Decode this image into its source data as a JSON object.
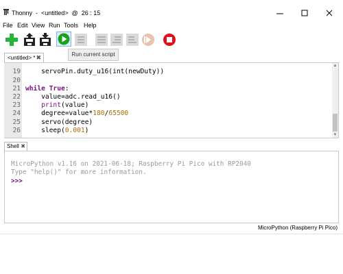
{
  "window": {
    "title": "Thonny  -  <untitled>  @  26 : 15",
    "app_icon": "thonny-logo-icon",
    "controls": [
      "minimize-icon",
      "maximize-icon",
      "close-icon"
    ]
  },
  "menu": [
    "File",
    "Edit",
    "View",
    "Run",
    "Tools",
    "Help"
  ],
  "toolbar": {
    "buttons": [
      {
        "name": "new-file-button",
        "icon": "plus-icon",
        "color": "#27b43a"
      },
      {
        "name": "open-file-button",
        "icon": "open-icon"
      },
      {
        "name": "save-file-button",
        "icon": "save-icon"
      },
      {
        "name": "run-button",
        "icon": "play-icon",
        "color": "#1ba11b"
      },
      {
        "name": "debug-button",
        "icon": "debug-icon",
        "enabled": false
      },
      {
        "name": "step-over-button",
        "icon": "step-over-icon",
        "enabled": false
      },
      {
        "name": "step-into-button",
        "icon": "step-into-icon",
        "enabled": false
      },
      {
        "name": "step-out-button",
        "icon": "step-out-icon",
        "enabled": false
      },
      {
        "name": "resume-button",
        "icon": "resume-icon",
        "enabled": false
      },
      {
        "name": "stop-button",
        "icon": "stop-icon",
        "color": "#e0101a"
      }
    ],
    "tooltip": "Run current script"
  },
  "editor": {
    "tab_label": "<untitled> *",
    "tab_close": "✖",
    "lines": [
      {
        "num": "19",
        "text": "    servoPin.duty_u16(int(newDuty))"
      },
      {
        "num": "20",
        "text": ""
      },
      {
        "num": "21",
        "text": "while True:"
      },
      {
        "num": "22",
        "text": "    value=adc.read_u16()"
      },
      {
        "num": "23",
        "text": "    print(value)"
      },
      {
        "num": "24",
        "text": "    degree=value*180/65500"
      },
      {
        "num": "25",
        "text": "    servo(degree)"
      },
      {
        "num": "26",
        "text": "    sleep(0.001)"
      }
    ]
  },
  "shell": {
    "tab_label": "Shell",
    "tab_close": "✖",
    "banner_line1": "MicroPython v1.16 on 2021-06-18; Raspberry Pi Pico with RP2040",
    "banner_line2": "Type \"help()\" for more information.",
    "prompt": ">>>"
  },
  "status": {
    "interpreter": "MicroPython (Raspberry Pi Pico)"
  },
  "colors": {
    "keyword": "#7b0f7b",
    "number": "#b06b00",
    "run_green": "#1ba11b",
    "stop_red": "#e0101a"
  }
}
